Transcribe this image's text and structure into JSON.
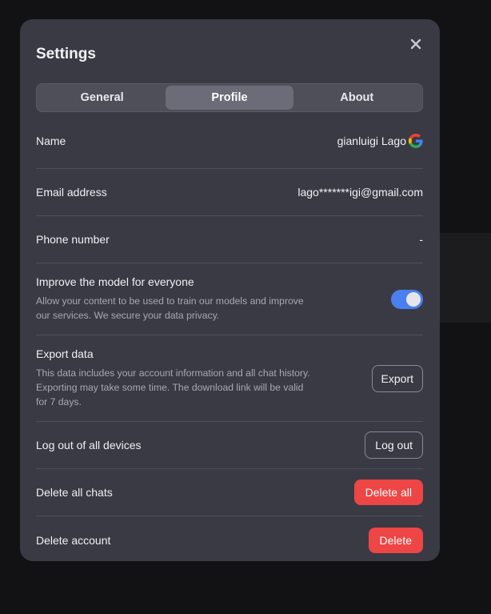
{
  "modal": {
    "title": "Settings",
    "close_icon": "close-icon"
  },
  "tabs": [
    {
      "label": "General",
      "active": false
    },
    {
      "label": "Profile",
      "active": true
    },
    {
      "label": "About",
      "active": false
    }
  ],
  "profile": {
    "name": {
      "label": "Name",
      "value": "gianluigi Lago",
      "provider_icon": "google-icon"
    },
    "email": {
      "label": "Email address",
      "value": "lago*******igi@gmail.com"
    },
    "phone": {
      "label": "Phone number",
      "value": "-"
    },
    "improve_model": {
      "label": "Improve the model for everyone",
      "description": "Allow your content to be used to train our models and improve our services. We secure your data privacy.",
      "enabled": true,
      "toggle_color": "#4a7ff0"
    },
    "export_data": {
      "label": "Export data",
      "description": "This data includes your account information and all chat history. Exporting may take some time. The download link will be valid for 7 days.",
      "button_label": "Export"
    },
    "logout_all": {
      "label": "Log out of all devices",
      "button_label": "Log out"
    },
    "delete_chats": {
      "label": "Delete all chats",
      "button_label": "Delete all"
    },
    "delete_account": {
      "label": "Delete account",
      "button_label": "Delete"
    }
  },
  "colors": {
    "danger": "#ee4545",
    "modal_bg": "#3a3a44",
    "page_bg": "#121214"
  }
}
